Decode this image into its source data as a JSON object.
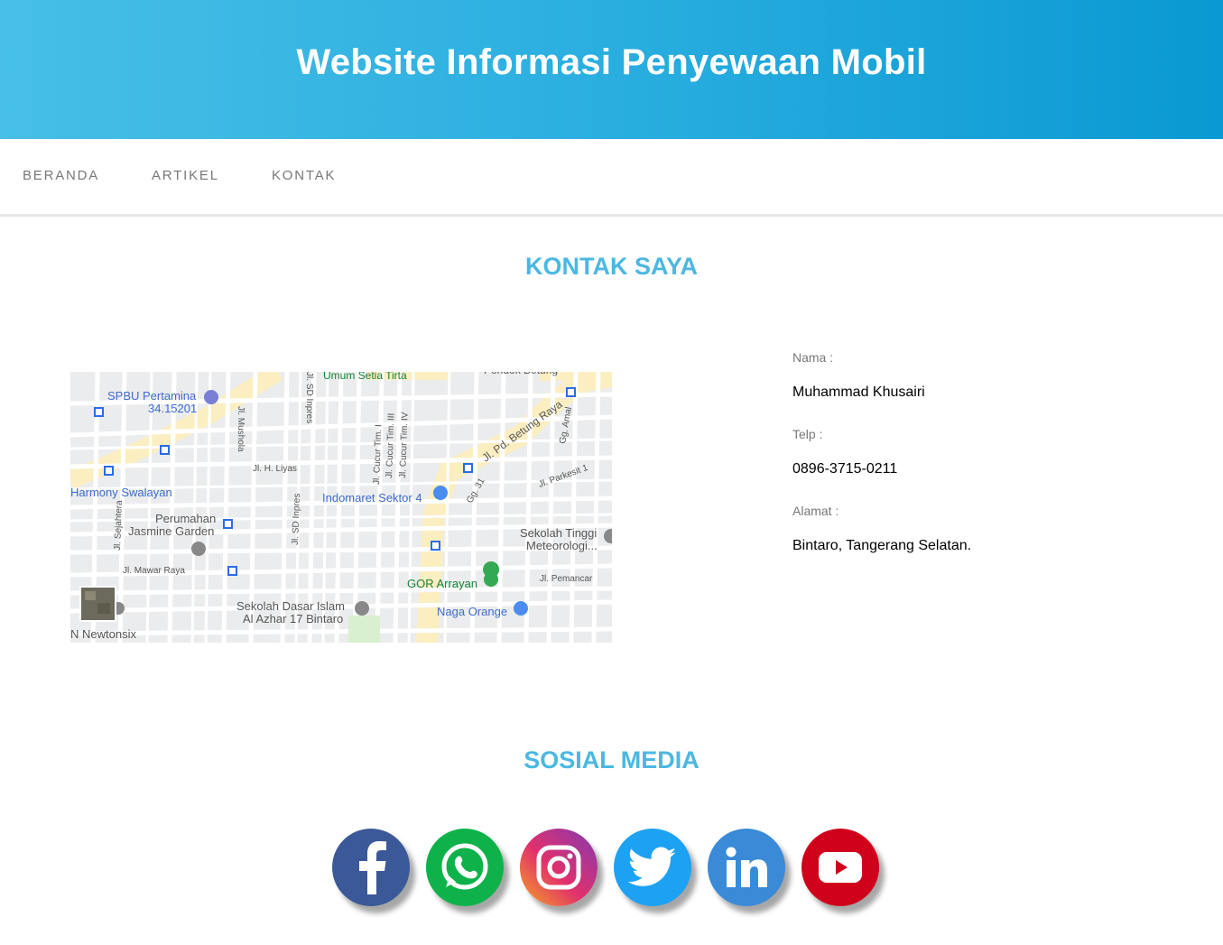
{
  "header": {
    "title": "Website Informasi Penyewaan Mobil"
  },
  "nav": {
    "items": [
      "BERANDA",
      "ARTIKEL",
      "KONTAK"
    ]
  },
  "contact": {
    "title": "KONTAK SAYA",
    "name_label": "Nama :",
    "name_value": "Muhammad Khusairi",
    "phone_label": "Telp :",
    "phone_value": "0896-3715-0211",
    "address_label": "Alamat :",
    "address_value": "Bintaro, Tangerang Selatan."
  },
  "map": {
    "places": [
      "SPBU Pertamina",
      "34.15201",
      "Harmony Swalayan",
      "Perumahan",
      "Jasmine Garden",
      "Indomaret Sektor 4",
      "GOR Arrayan",
      "Naga Orange",
      "Sekolah Tinggi",
      "Meteorologi...",
      "Sekolah Dasar Islam",
      "Al Azhar 17 Bintaro",
      "N Newtonsix",
      "Umum Setia Tirta",
      "Pondok Betung"
    ],
    "streets": [
      "Jl. Pd. Betung Raya",
      "Jl. H. Liyas",
      "Jl. Mushola",
      "Jl. SD Inpres",
      "Jl. Cucur Tim. I",
      "Jl. Cucur Tim. III",
      "Jl. Cucur Tim. IV",
      "Jl. Sejahtera",
      "Jl. Mawar Raya",
      "Jl. Pemancar",
      "Jl. Parkesit 1",
      "Gg. 31",
      "Gg. Amal"
    ]
  },
  "social": {
    "title": "SOSIAL MEDIA",
    "icons": [
      "facebook-icon",
      "whatsapp-icon",
      "instagram-icon",
      "twitter-icon",
      "linkedin-icon",
      "youtube-icon"
    ],
    "colors": {
      "facebook": "#3b5998",
      "whatsapp": "#0fb24a",
      "instagram": "#c1358a",
      "twitter": "#1da1f2",
      "linkedin": "#3a8ad8",
      "youtube": "#d0021b"
    }
  },
  "colors": {
    "accent": "#4bb8e2",
    "header_start": "#47bfe6",
    "header_end": "#0a99d2"
  }
}
